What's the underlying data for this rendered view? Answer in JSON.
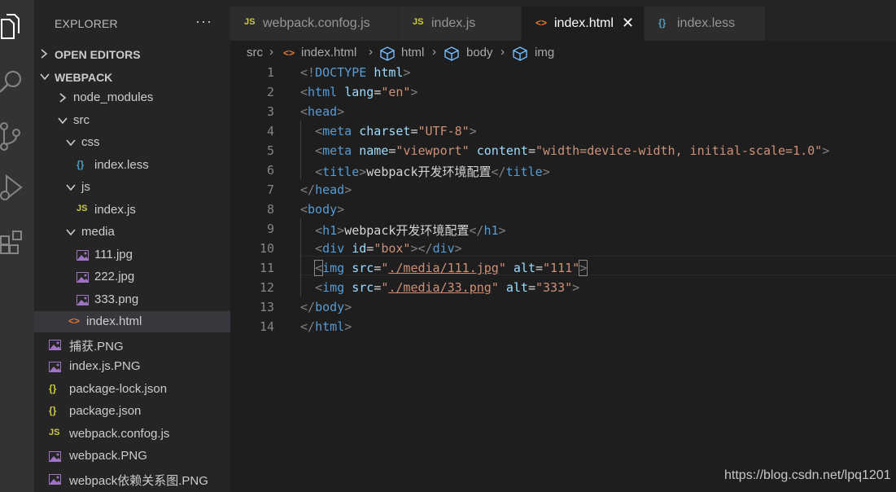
{
  "activity_bar": {
    "icons": [
      "files-icon",
      "search-icon",
      "source-control-icon",
      "run-debug-icon",
      "extensions-icon"
    ]
  },
  "sidebar": {
    "title": "EXPLORER",
    "more": "···",
    "open_editors": "OPEN EDITORS",
    "project": "WEBPACK",
    "tree": [
      {
        "label": "node_modules",
        "type": "folder-collapsed"
      },
      {
        "label": "src",
        "type": "folder-open"
      },
      {
        "label": "css",
        "type": "folder-open"
      },
      {
        "label": "index.less",
        "type": "less"
      },
      {
        "label": "js",
        "type": "folder-open"
      },
      {
        "label": "index.js",
        "type": "js"
      },
      {
        "label": "media",
        "type": "folder-open"
      },
      {
        "label": "111.jpg",
        "type": "image"
      },
      {
        "label": "222.jpg",
        "type": "image"
      },
      {
        "label": "333.png",
        "type": "image"
      },
      {
        "label": "index.html",
        "type": "html",
        "active": true
      },
      {
        "label": "捕获.PNG",
        "type": "image"
      },
      {
        "label": "index.js.PNG",
        "type": "image"
      },
      {
        "label": "package-lock.json",
        "type": "json"
      },
      {
        "label": "package.json",
        "type": "json"
      },
      {
        "label": "webpack.confog.js",
        "type": "js"
      },
      {
        "label": "webpack.PNG",
        "type": "image"
      },
      {
        "label": "webpack依赖关系图.PNG",
        "type": "image"
      }
    ]
  },
  "icon_glyphs": {
    "js": "JS",
    "json": "{}",
    "less": "{}",
    "html": "<>",
    "close": "✕"
  },
  "tabs": [
    {
      "label": "webpack.confog.js",
      "icon": "JS",
      "active": false
    },
    {
      "label": "index.js",
      "icon": "JS",
      "active": false
    },
    {
      "label": "index.html",
      "icon": "<>",
      "active": true
    },
    {
      "label": "index.less",
      "icon": "{}",
      "active": false
    }
  ],
  "breadcrumb": [
    "src",
    "index.html",
    "html",
    "body",
    "img"
  ],
  "editor": {
    "line_numbers": [
      "1",
      "2",
      "3",
      "4",
      "5",
      "6",
      "7",
      "8",
      "9",
      "10",
      "11",
      "12",
      "13",
      "14"
    ],
    "lines": [
      [
        [
          "br",
          "<!"
        ],
        [
          "tag",
          "DOCTYPE"
        ],
        [
          "txt",
          " "
        ],
        [
          "attr",
          "html"
        ],
        [
          "br",
          ">"
        ]
      ],
      [
        [
          "br",
          "<"
        ],
        [
          "tag",
          "html"
        ],
        [
          "txt",
          " "
        ],
        [
          "attr",
          "lang"
        ],
        [
          "txt",
          "="
        ],
        [
          "str",
          "\"en\""
        ],
        [
          "br",
          ">"
        ]
      ],
      [
        [
          "br",
          "<"
        ],
        [
          "tag",
          "head"
        ],
        [
          "br",
          ">"
        ]
      ],
      [
        [
          "txt",
          "  "
        ],
        [
          "br",
          "<"
        ],
        [
          "tag",
          "meta"
        ],
        [
          "txt",
          " "
        ],
        [
          "attr",
          "charset"
        ],
        [
          "txt",
          "="
        ],
        [
          "str",
          "\"UTF-8\""
        ],
        [
          "br",
          ">"
        ]
      ],
      [
        [
          "txt",
          "  "
        ],
        [
          "br",
          "<"
        ],
        [
          "tag",
          "meta"
        ],
        [
          "txt",
          " "
        ],
        [
          "attr",
          "name"
        ],
        [
          "txt",
          "="
        ],
        [
          "str",
          "\"viewport\""
        ],
        [
          "txt",
          " "
        ],
        [
          "attr",
          "content"
        ],
        [
          "txt",
          "="
        ],
        [
          "str",
          "\"width=device-width, initial-scale=1.0\""
        ],
        [
          "br",
          ">"
        ]
      ],
      [
        [
          "txt",
          "  "
        ],
        [
          "br",
          "<"
        ],
        [
          "tag",
          "title"
        ],
        [
          "br",
          ">"
        ],
        [
          "txt",
          "webpack开发环境配置"
        ],
        [
          "br",
          "</"
        ],
        [
          "tag",
          "title"
        ],
        [
          "br",
          ">"
        ]
      ],
      [
        [
          "br",
          "</"
        ],
        [
          "tag",
          "head"
        ],
        [
          "br",
          ">"
        ]
      ],
      [
        [
          "br",
          "<"
        ],
        [
          "tag",
          "body"
        ],
        [
          "br",
          ">"
        ]
      ],
      [
        [
          "txt",
          "  "
        ],
        [
          "br",
          "<"
        ],
        [
          "tag",
          "h1"
        ],
        [
          "br",
          ">"
        ],
        [
          "txt",
          "webpack开发环境配置"
        ],
        [
          "br",
          "</"
        ],
        [
          "tag",
          "h1"
        ],
        [
          "br",
          ">"
        ]
      ],
      [
        [
          "txt",
          "  "
        ],
        [
          "br",
          "<"
        ],
        [
          "tag",
          "div"
        ],
        [
          "txt",
          " "
        ],
        [
          "attr",
          "id"
        ],
        [
          "txt",
          "="
        ],
        [
          "str",
          "\"box\""
        ],
        [
          "br",
          "></"
        ],
        [
          "tag",
          "div"
        ],
        [
          "br",
          ">"
        ]
      ],
      [
        [
          "txt",
          "  "
        ],
        [
          "hl",
          "<"
        ],
        [
          "tag",
          "img"
        ],
        [
          "txt",
          " "
        ],
        [
          "attr",
          "src"
        ],
        [
          "txt",
          "="
        ],
        [
          "str",
          "\""
        ],
        [
          "link",
          "./media/111.jpg"
        ],
        [
          "str",
          "\""
        ],
        [
          "txt",
          " "
        ],
        [
          "attr",
          "alt"
        ],
        [
          "txt",
          "="
        ],
        [
          "str",
          "\"111\""
        ],
        [
          "hl",
          ">"
        ]
      ],
      [
        [
          "txt",
          "  "
        ],
        [
          "br",
          "<"
        ],
        [
          "tag",
          "img"
        ],
        [
          "txt",
          " "
        ],
        [
          "attr",
          "src"
        ],
        [
          "txt",
          "="
        ],
        [
          "str",
          "\""
        ],
        [
          "link",
          "./media/33.png"
        ],
        [
          "str",
          "\""
        ],
        [
          "txt",
          " "
        ],
        [
          "attr",
          "alt"
        ],
        [
          "txt",
          "="
        ],
        [
          "str",
          "\"333\""
        ],
        [
          "br",
          ">"
        ]
      ],
      [
        [
          "br",
          "</"
        ],
        [
          "tag",
          "body"
        ],
        [
          "br",
          ">"
        ]
      ],
      [
        [
          "br",
          "</"
        ],
        [
          "tag",
          "html"
        ],
        [
          "br",
          ">"
        ]
      ]
    ]
  },
  "watermark": "https://blog.csdn.net/lpq1201"
}
